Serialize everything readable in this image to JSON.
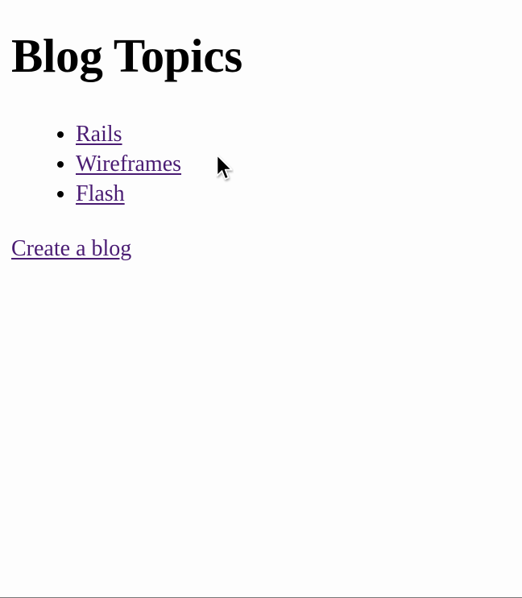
{
  "page": {
    "title": "Blog Topics"
  },
  "topics": [
    {
      "label": "Rails"
    },
    {
      "label": "Wireframes"
    },
    {
      "label": "Flash"
    }
  ],
  "actions": {
    "create_blog_label": "Create a blog"
  },
  "icons": {
    "cursor": "mouse-pointer-arrow"
  },
  "colors": {
    "background": "#fdfdfd",
    "text": "#000000",
    "link_visited": "#4a1c73"
  }
}
